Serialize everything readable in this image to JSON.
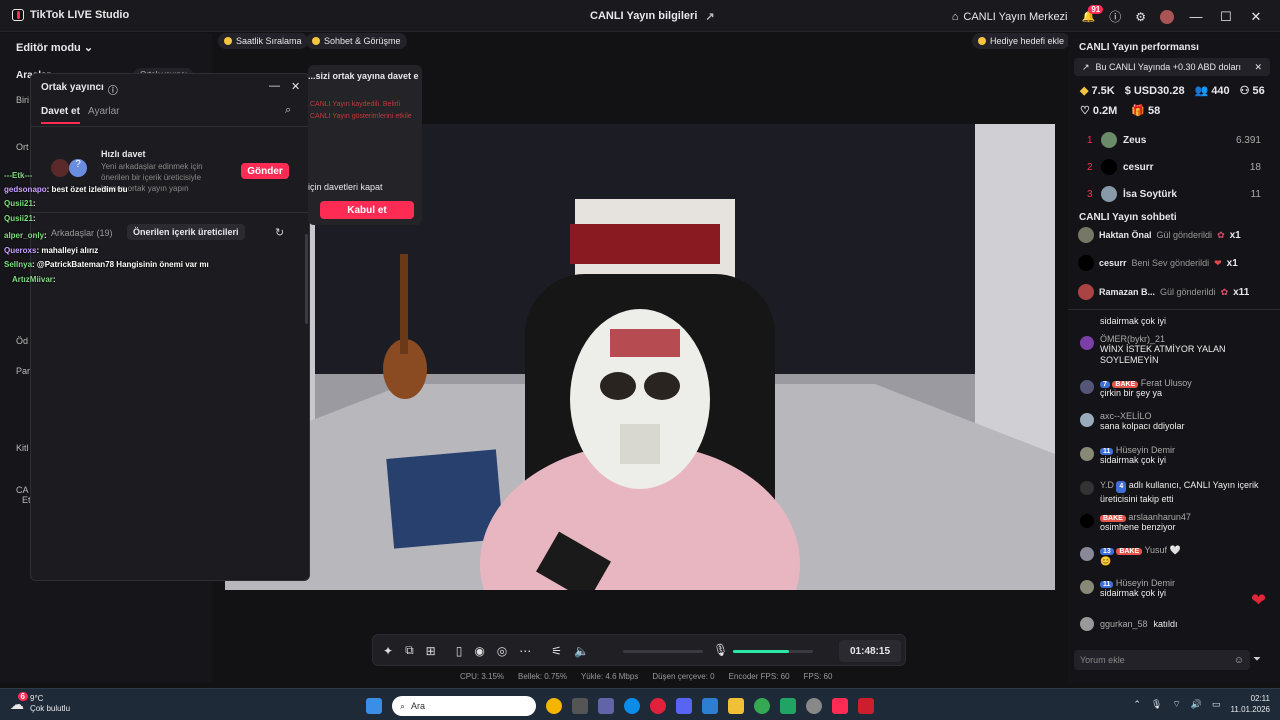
{
  "titlebar": {
    "app_name": "TikTok LIVE Studio",
    "center_title": "CANLI Yayın bilgileri",
    "live_center": "CANLI Yayın Merkezi",
    "notif_count": "91"
  },
  "left": {
    "mode": "Editör modu",
    "tools_title": "Araçlar",
    "cohost_chip": "Ortak yayıncı",
    "side_labels": [
      "Biri",
      "Ort",
      "Öd",
      "Par",
      "Kitl",
      "CA",
      "Et"
    ]
  },
  "top_chips": [
    "Saatlik Sıralama",
    "Sohbet & Görüşme"
  ],
  "goal_chip": "Hediye hedefi ekle",
  "cohost_dialog": {
    "title": "Ortak yayıncı",
    "tab_invite": "Davet et",
    "tab_settings": "Ayarlar",
    "quick_title": "Hızlı davet",
    "quick_desc": "Yeni arkadaşlar edinmek için önerilen bir içerik üreticisiyle hemen ortak yayın yapın",
    "send_btn": "Gönder",
    "friends_tab": "Arkadaşlar (19)",
    "suggested_tab": "Önerilen içerik üreticileri"
  },
  "invite_panel": {
    "header": "...sizi ortak yayına davet e",
    "body": "CANLI Yayın kaydedili. Belirli CANLI Yayın gösterimlerini etkile",
    "close_invites": "için davetleri kapat",
    "accept_btn": "Kabul et"
  },
  "overlay_chat": [
    {
      "user": "---Etk---",
      "msg": ""
    },
    {
      "user": "gedsonapo",
      "msg": ": best özet izledim bu"
    },
    {
      "user": "Qusii21",
      "msg": ":"
    },
    {
      "user": "Qusii21",
      "msg": ":"
    },
    {
      "user": "alper_only",
      "msg": ":"
    },
    {
      "user": "Queroxs",
      "msg": ": mahalleyi alırız"
    },
    {
      "user": "Sellnya",
      "msg": ": @PatrickBateman78 Hangisinin önemi var mı"
    },
    {
      "user": "ArtızMiivar",
      "msg": ":"
    }
  ],
  "right": {
    "perf_title": "CANLI Yayın performansı",
    "banner": "Bu CANLI Yayında +0.30 ABD doları",
    "stats": {
      "diamonds": "7.5K",
      "usd": "USD30.28",
      "viewers": "440",
      "new": "56",
      "likes": "0.2M",
      "gifters": "58"
    },
    "ranking": [
      {
        "rank": "1",
        "name": "Zeus",
        "score": "6.391"
      },
      {
        "rank": "2",
        "name": "cesurr",
        "score": "18"
      },
      {
        "rank": "3",
        "name": "İsa Soytürk",
        "score": "11"
      }
    ],
    "chat_title": "CANLI Yayın sohbeti",
    "gifts": [
      {
        "name": "Haktan Önal",
        "action": "Gül gönderildi",
        "count": "x1"
      },
      {
        "name": "cesurr",
        "action": "Beni Sev gönderildi",
        "count": "x1"
      },
      {
        "name": "Ramazan B...",
        "action": "Gül gönderildi",
        "count": "x11"
      }
    ],
    "messages": [
      {
        "user": "",
        "text": "sidairmak çok iyi"
      },
      {
        "user": "ÖMER(bykr)_21",
        "text": "WİNX İSTEK ATMİYOR YALAN SOYLEMEYİN"
      },
      {
        "user": "Ferat Ulusoy",
        "level": "7",
        "fan": "BAKE",
        "text": "çirkin bir şey ya"
      },
      {
        "user": "axc--XELİLO",
        "text": "sana kolpacı ddiyolar"
      },
      {
        "user": "Hüseyin Demir",
        "level": "11",
        "text": "sidairmak çok iyi"
      },
      {
        "user": "Y.D",
        "level": "4",
        "text": "adlı kullanıcı, CANLI Yayın içerik üreticisini takip etti"
      },
      {
        "user": "arslaanharun47",
        "fan": "BAKE",
        "text": "osimhene benziyor"
      },
      {
        "user": "Yusuf",
        "level": "13",
        "fan": "BAKE",
        "text": "😊"
      },
      {
        "user": "Hüseyin Demir",
        "level": "11",
        "text": "sidairmak çok iyi"
      },
      {
        "user": "ggurkan_58",
        "text": "katıldı"
      }
    ],
    "comment_placeholder": "Yorum ekle"
  },
  "controls": {
    "timer": "01:48:15",
    "volume_level": 0.7
  },
  "status": {
    "cpu": "CPU: 3.15%",
    "mem": "Bellek: 0.75%",
    "upload": "Yükle: 4.6 Mbps",
    "dropped": "Düşen çerçeve: 0",
    "encoder": "Encoder FPS: 60",
    "fps": "FPS: 60"
  },
  "taskbar": {
    "temp": "9°C",
    "weather": "Çok bulutlu",
    "weather_badge": "6",
    "search": "Ara",
    "time": "02:11",
    "date": "11.01.2026"
  },
  "colors": {
    "accent": "#fe2c55",
    "panel": "#16161a",
    "volume": "#2ee6a6"
  }
}
